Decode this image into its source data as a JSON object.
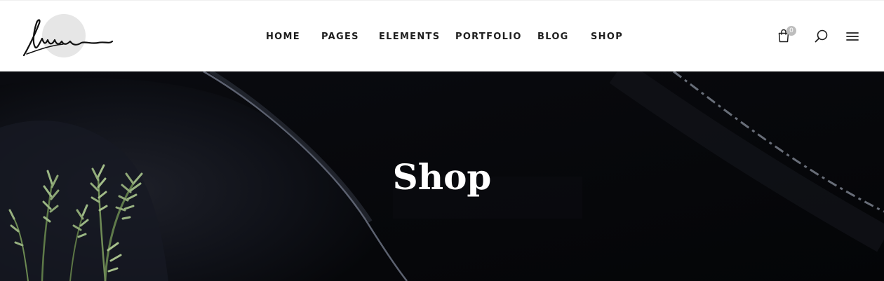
{
  "header": {
    "logo": {
      "icon": "signature-logo"
    },
    "nav": {
      "home": "HOME",
      "pages": "PAGES",
      "elements": "ELEMENTS",
      "portfolio": "PORTFOLIO",
      "blog": "BLOG",
      "shop": "SHOP"
    },
    "cart": {
      "icon": "shopping-bag-icon",
      "count": "0"
    },
    "search": {
      "icon": "search-icon"
    },
    "menu": {
      "icon": "hamburger-menu-icon"
    }
  },
  "hero": {
    "title": "Shop",
    "background": "dark-plate-with-rosemary"
  },
  "colors": {
    "header_bg": "#ffffff",
    "nav_text": "#1f1f1f",
    "hero_bg": "#07080b",
    "hero_text": "#ffffff",
    "badge": "#bdbdbd"
  }
}
